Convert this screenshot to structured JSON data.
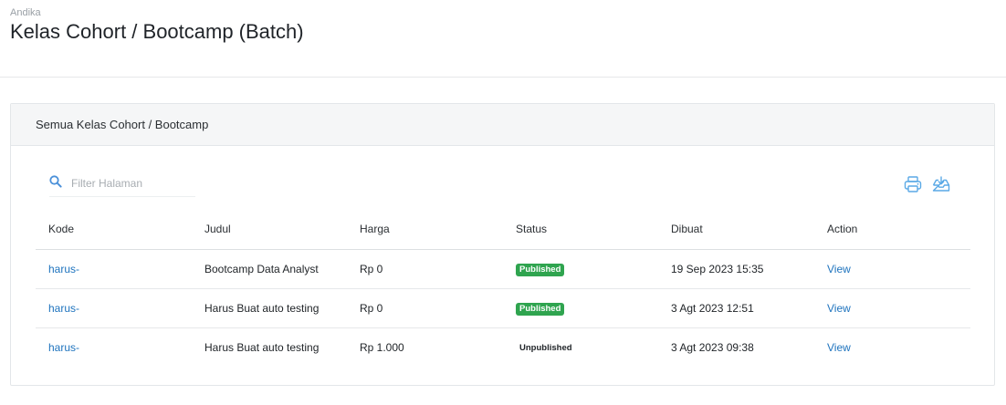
{
  "header": {
    "breadcrumb": "Andika",
    "title": "Kelas Cohort / Bootcamp (Batch)"
  },
  "card": {
    "title": "Semua Kelas Cohort / Bootcamp",
    "search": {
      "placeholder": "Filter Halaman",
      "value": ""
    },
    "tools": {
      "print_icon": "printer-icon",
      "export_icon": "download-tray-icon"
    }
  },
  "table": {
    "columns": [
      "Kode",
      "Judul",
      "Harga",
      "Status",
      "Dibuat",
      "Action"
    ],
    "rows": [
      {
        "kode": "harus-",
        "judul": "Bootcamp Data Analyst",
        "harga": "Rp 0",
        "status": "Published",
        "dibuat": "19 Sep 2023 15:35",
        "action": "View"
      },
      {
        "kode": "harus-",
        "judul": "Harus Buat auto testing",
        "harga": "Rp 0",
        "status": "Published",
        "dibuat": "3 Agt 2023 12:51",
        "action": "View"
      },
      {
        "kode": "harus-",
        "judul": "Harus Buat auto testing",
        "harga": "Rp 1.000",
        "status": "Unpublished",
        "dibuat": "3 Agt 2023 09:38",
        "action": "View"
      }
    ]
  },
  "colors": {
    "accent_blue": "#1e73be",
    "published_green": "#2fa44f",
    "icon_blue": "#5aa9e6"
  }
}
